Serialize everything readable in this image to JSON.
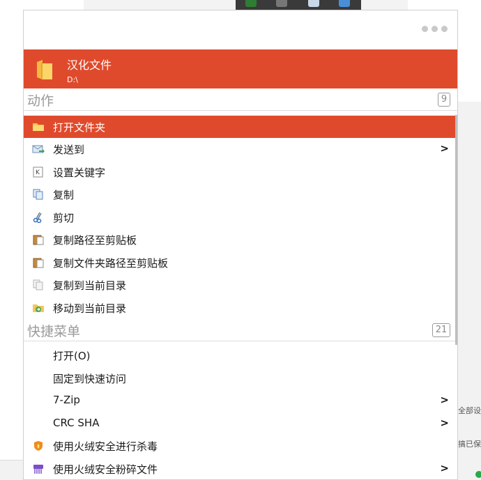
{
  "header": {
    "title": "汉化文件",
    "path": "D:\\"
  },
  "sections": {
    "actions": {
      "title": "动作",
      "count": "9"
    },
    "quickmenu": {
      "title": "快捷菜单",
      "count": "21"
    }
  },
  "actions": [
    {
      "label": "打开文件夹",
      "icon": "folder-open-icon",
      "active": true,
      "submenu": false
    },
    {
      "label": "发送到",
      "icon": "send-mail-icon",
      "active": false,
      "submenu": true
    },
    {
      "label": "设置关键字",
      "icon": "keyword-icon",
      "active": false,
      "submenu": false
    },
    {
      "label": "复制",
      "icon": "copy-icon",
      "active": false,
      "submenu": false
    },
    {
      "label": "剪切",
      "icon": "scissors-icon",
      "active": false,
      "submenu": false
    },
    {
      "label": "复制路径至剪贴板",
      "icon": "clipboard-icon",
      "active": false,
      "submenu": false
    },
    {
      "label": "复制文件夹路径至剪贴板",
      "icon": "clipboard-icon",
      "active": false,
      "submenu": false
    },
    {
      "label": "复制到当前目录",
      "icon": "copy-light-icon",
      "active": false,
      "submenu": false
    },
    {
      "label": "移动到当前目录",
      "icon": "move-icon",
      "active": false,
      "submenu": false
    }
  ],
  "quick": [
    {
      "label": "打开(O)",
      "icon": "",
      "submenu": false
    },
    {
      "label": "固定到快速访问",
      "icon": "",
      "submenu": false
    },
    {
      "label": "7-Zip",
      "icon": "",
      "submenu": true
    },
    {
      "label": "CRC SHA",
      "icon": "",
      "submenu": true
    },
    {
      "label": "使用火绒安全进行杀毒",
      "icon": "huorong-shield-icon",
      "submenu": false
    },
    {
      "label": "使用火绒安全粉碎文件",
      "icon": "shredder-icon",
      "submenu": true
    }
  ],
  "background": {
    "text1": "全部设",
    "text2": "搞已保"
  },
  "colors": {
    "accent": "#e04a2c"
  }
}
